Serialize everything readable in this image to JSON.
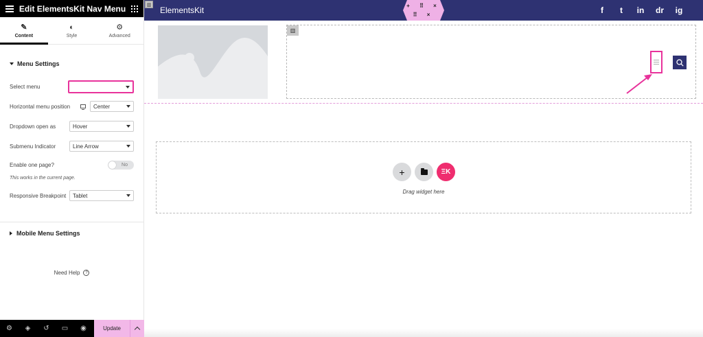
{
  "panel": {
    "title": "Edit ElementsKit Nav Menu",
    "tabs": [
      {
        "label": "Content",
        "icon": "pencil-icon",
        "active": true
      },
      {
        "label": "Style",
        "icon": "half-circle-icon",
        "active": false
      },
      {
        "label": "Advanced",
        "icon": "gear-icon",
        "active": false
      }
    ],
    "menu_settings": {
      "heading": "Menu Settings",
      "select_menu": {
        "label": "Select menu",
        "value": ""
      },
      "horizontal_position": {
        "label": "Horizontal menu position",
        "value": "Center"
      },
      "dropdown_open": {
        "label": "Dropdown open as",
        "value": "Hover"
      },
      "submenu_indicator": {
        "label": "Submenu Indicator",
        "value": "Line Arrow"
      },
      "one_page": {
        "label": "Enable one page?",
        "toggle_text": "No",
        "note": "This works in the current page."
      },
      "breakpoint": {
        "label": "Responsive Breakpoint",
        "value": "Tablet"
      }
    },
    "mobile_settings": {
      "heading": "Mobile Menu Settings"
    },
    "help": {
      "label": "Need Help",
      "q": "?"
    },
    "footer": {
      "update_label": "Update"
    }
  },
  "canvas": {
    "brand": "ElementsKit",
    "social": [
      "f",
      "t",
      "in",
      "dr",
      "ig"
    ],
    "section_tab": "▥",
    "column_handle": "▥",
    "hex_controls": {
      "top": "+ ⠿ ×",
      "bottom": "⠿ ×"
    },
    "drop_zone": {
      "add": "+",
      "brand_mark": "ΞK",
      "text": "Drag widget here"
    }
  },
  "colors": {
    "topbar": "#2e3272",
    "highlight": "#e8329b",
    "update_bg": "#f2b8e8",
    "ek_button": "#ef2d6f"
  }
}
